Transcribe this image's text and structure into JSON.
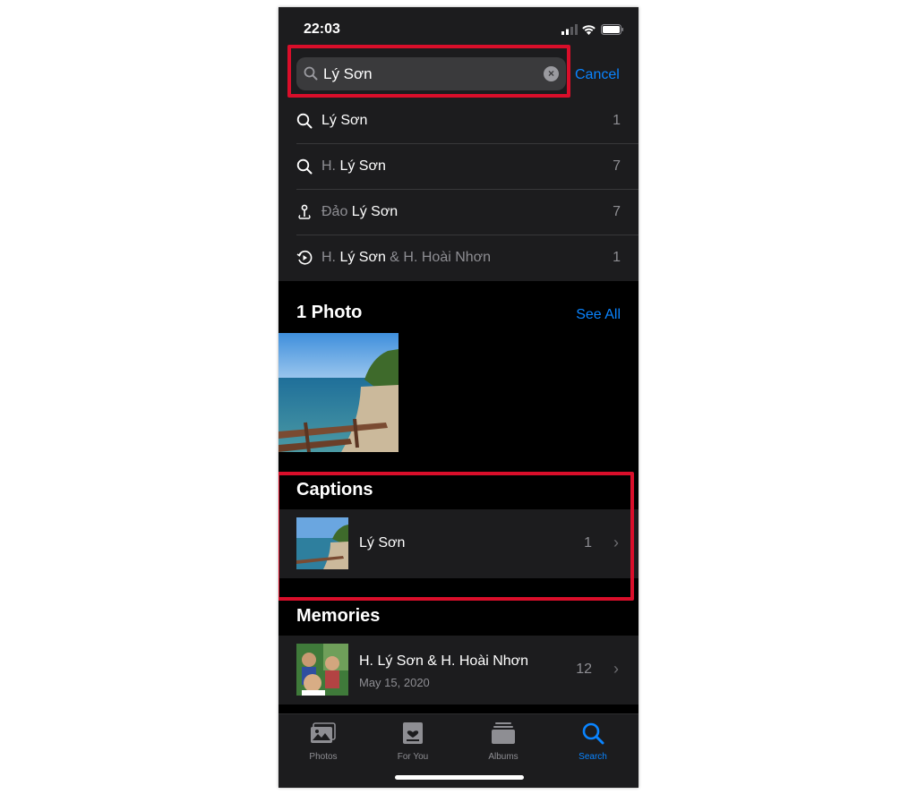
{
  "status_bar": {
    "time": "22:03",
    "icons": [
      "cellular-signal-icon",
      "wifi-icon",
      "battery-icon"
    ]
  },
  "search": {
    "query": "Lý Sơn",
    "cancel_label": "Cancel",
    "search_icon": "search-icon",
    "clear_icon": "clear-icon"
  },
  "suggestions": [
    {
      "icon": "search-icon",
      "prefix": "",
      "match": "Lý Sơn",
      "suffix": "",
      "count": "1"
    },
    {
      "icon": "search-icon",
      "prefix": "H. ",
      "match": "Lý Sơn",
      "suffix": "",
      "count": "7"
    },
    {
      "icon": "location-pin-icon",
      "prefix": "Đảo ",
      "match": "Lý Sơn",
      "suffix": "",
      "count": "7"
    },
    {
      "icon": "memories-icon",
      "prefix": "H. ",
      "match": "Lý Sơn",
      "suffix": " & H. Hoài Nhơn",
      "count": "1"
    }
  ],
  "photos_section": {
    "title": "1 Photo",
    "see_all_label": "See All"
  },
  "captions_section": {
    "title": "Captions",
    "item": {
      "title": "Lý Sơn",
      "count": "1"
    }
  },
  "memories_section": {
    "title": "Memories",
    "item": {
      "title": "H. Lý Sơn & H. Hoài Nhơn",
      "date": "May 15, 2020",
      "count": "12"
    }
  },
  "tab_bar": {
    "tabs": [
      {
        "label": "Photos",
        "icon": "photos-icon",
        "active": false
      },
      {
        "label": "For You",
        "icon": "for-you-icon",
        "active": false
      },
      {
        "label": "Albums",
        "icon": "albums-icon",
        "active": false
      },
      {
        "label": "Search",
        "icon": "search-icon",
        "active": true
      }
    ]
  },
  "colors": {
    "accent": "#0a84ff",
    "highlight": "#d90e2a",
    "background": "#000000",
    "cell": "#1c1c1e"
  }
}
